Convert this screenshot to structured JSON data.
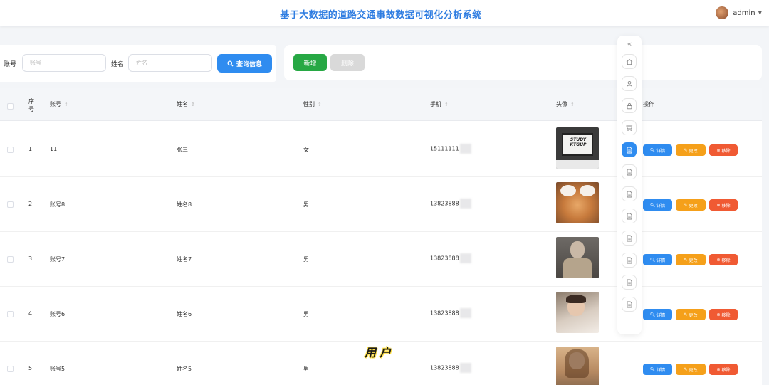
{
  "header": {
    "title": "基于大数据的道路交通事故数据可视化分析系统",
    "username": "admin"
  },
  "search": {
    "account_label": "账号",
    "account_placeholder": "账号",
    "name_label": "姓名",
    "name_placeholder": "姓名",
    "query_label": "查询信息"
  },
  "actions": {
    "add_label": "新增",
    "delete_label": "删除"
  },
  "table": {
    "headers": {
      "index": "序号",
      "account": "账号",
      "name": "姓名",
      "gender": "性别",
      "phone": "手机",
      "avatar": "头像",
      "ops": "操作"
    },
    "rows": [
      {
        "index": "1",
        "account": "11",
        "name": "张三",
        "gender": "女",
        "phone": "15111111"
      },
      {
        "index": "2",
        "account": "账号8",
        "name": "姓名8",
        "gender": "男",
        "phone": "13823888"
      },
      {
        "index": "3",
        "account": "账号7",
        "name": "姓名7",
        "gender": "男",
        "phone": "13823888"
      },
      {
        "index": "4",
        "account": "账号6",
        "name": "姓名6",
        "gender": "男",
        "phone": "13823888"
      },
      {
        "index": "5",
        "account": "账号5",
        "name": "姓名5",
        "gender": "男",
        "phone": "13823888"
      }
    ],
    "op_labels": {
      "detail": "详情",
      "edit": "更改",
      "remove": "移除"
    }
  },
  "photo1_text": "STUDY KTGUP",
  "overlay_caption": "用户",
  "colors": {
    "primary": "#2f8cf0",
    "success": "#27a844",
    "warning": "#f5a01a",
    "danger": "#f05a33",
    "title": "#2f7de1"
  }
}
